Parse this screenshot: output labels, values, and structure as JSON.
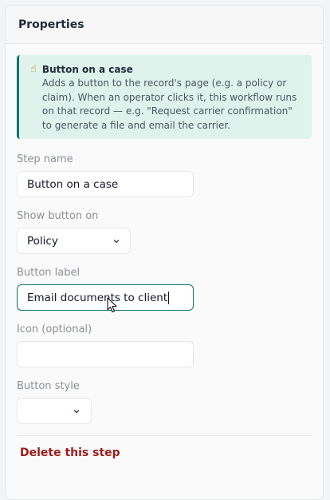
{
  "panel": {
    "title": "Properties"
  },
  "callout": {
    "icon": "pointing-finger-icon",
    "title": "Button on a case",
    "text": "Adds a button to the record's page (e.g. a policy or claim). When an operator clicks it, this workflow runs on that record — e.g. \"Request carrier confirmation\" to generate a file and email the carrier."
  },
  "fields": {
    "step_name": {
      "label": "Step name",
      "value": "Button on a case"
    },
    "show_button_on": {
      "label": "Show button on",
      "value": "Policy"
    },
    "button_label": {
      "label": "Button label",
      "value": "Email documents to client"
    },
    "icon": {
      "label": "Icon (optional)",
      "value": ""
    },
    "button_style": {
      "label": "Button style",
      "value": ""
    }
  },
  "actions": {
    "delete_label": "Delete this step"
  },
  "colors": {
    "accent": "#0f766e",
    "danger": "#9b1c1c",
    "callout_bg": "#dff3ec"
  }
}
